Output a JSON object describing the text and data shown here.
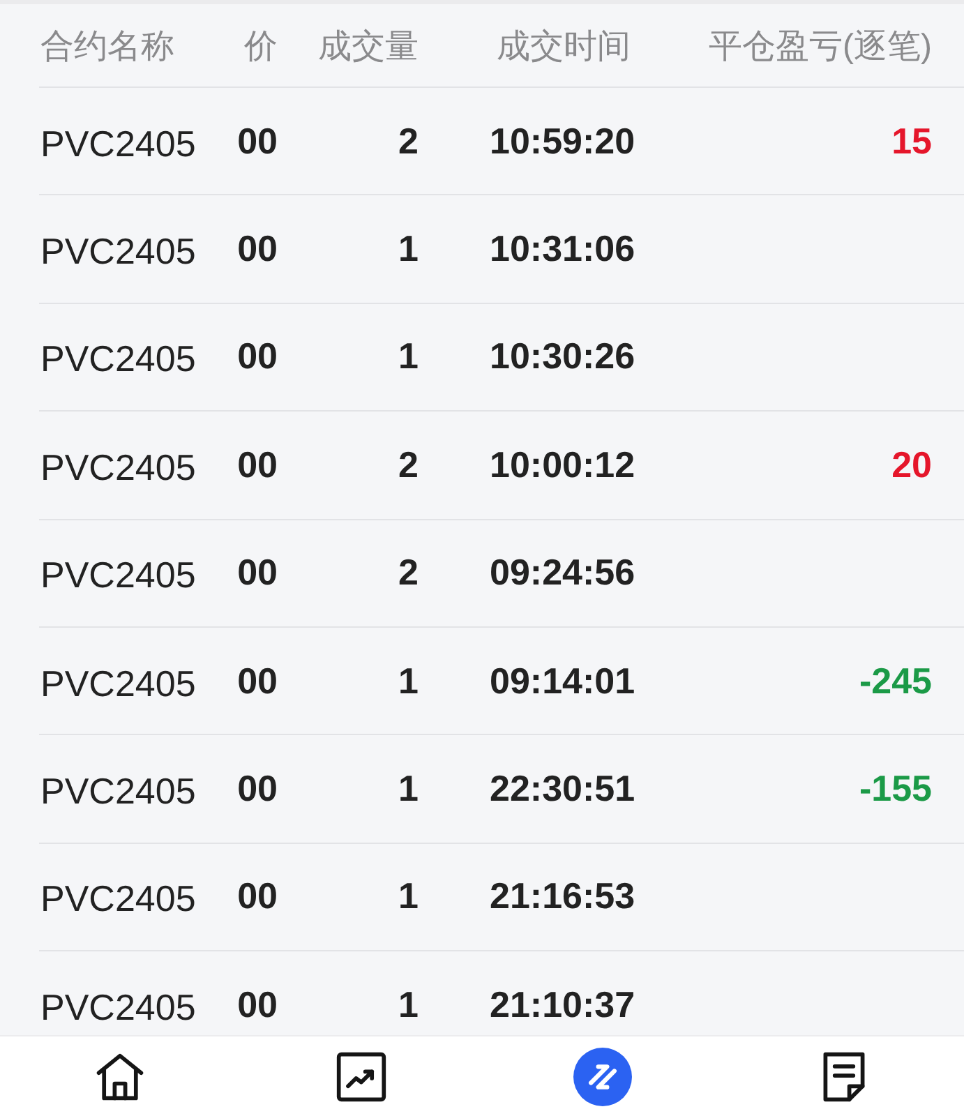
{
  "table": {
    "columns": [
      "合约名称",
      "价",
      "成交量",
      "成交时间",
      "平仓盈亏(逐笔)"
    ],
    "rows": [
      {
        "contract": "PVC2405",
        "price": "00",
        "volume": "2",
        "time": "10:59:20",
        "pnl": "15",
        "color": "#e5162b"
      },
      {
        "contract": "PVC2405",
        "price": "00",
        "volume": "1",
        "time": "10:31:06"
      },
      {
        "contract": "PVC2405",
        "price": "00",
        "volume": "1",
        "time": "10:30:26"
      },
      {
        "contract": "PVC2405",
        "price": "00",
        "volume": "2",
        "time": "10:00:12",
        "pnl": "20",
        "color": "#e5162b"
      },
      {
        "contract": "PVC2405",
        "price": "00",
        "volume": "2",
        "time": "09:24:56"
      },
      {
        "contract": "PVC2405",
        "price": "00",
        "volume": "1",
        "time": "09:14:01",
        "pnl": "-245",
        "color": "#1b9a47"
      },
      {
        "contract": "PVC2405",
        "price": "00",
        "volume": "1",
        "time": "22:30:51",
        "pnl": "-155",
        "color": "#1b9a47"
      },
      {
        "contract": "PVC2405",
        "price": "00",
        "volume": "1",
        "time": "21:16:53"
      },
      {
        "contract": "PVC2405",
        "price": "00",
        "volume": "1",
        "time": "21:10:37"
      }
    ]
  },
  "bottom_nav": [
    {
      "kind": "home",
      "selected": false
    },
    {
      "kind": "chart",
      "selected": false
    },
    {
      "kind": "swap",
      "selected": true
    },
    {
      "kind": "document",
      "selected": false
    }
  ]
}
